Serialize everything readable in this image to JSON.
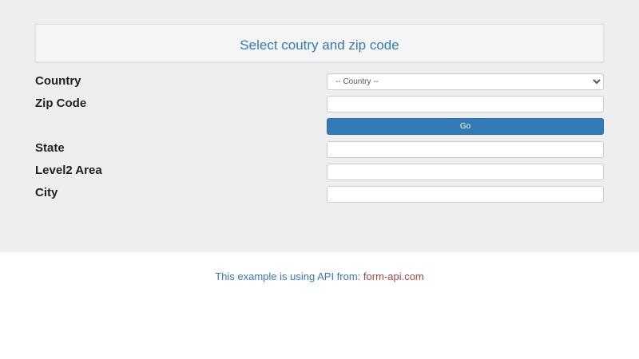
{
  "header": {
    "title": "Select coutry and zip code"
  },
  "form": {
    "country_label": "Country",
    "country_selected": "-- Country --",
    "zip_label": "Zip Code",
    "zip_value": "",
    "go_label": "Go",
    "state_label": "State",
    "state_value": "",
    "level2_label": "Level2 Area",
    "level2_value": "",
    "city_label": "City",
    "city_value": ""
  },
  "footer": {
    "text": "This example is using API from: ",
    "link_text": "form-api.com"
  },
  "colors": {
    "accent": "#337ab7",
    "link": "#a94442",
    "panel_bg": "#eeeeee"
  }
}
